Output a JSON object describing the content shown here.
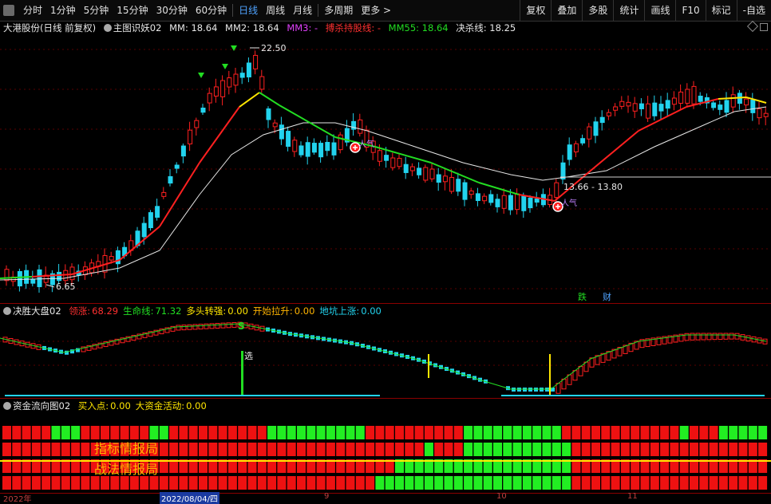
{
  "toolbar": {
    "periods": [
      "分时",
      "1分钟",
      "5分钟",
      "15分钟",
      "30分钟",
      "60分钟",
      "日线",
      "周线",
      "月线",
      "多周期",
      "更多 >"
    ],
    "active_period": "日线",
    "right_buttons": [
      "复权",
      "叠加",
      "多股",
      "统计",
      "画线",
      "F10",
      "标记",
      "-自选"
    ]
  },
  "main_chart": {
    "stock_title": "大港股份(日线 前复权)",
    "indicator_name": "主图识妖02",
    "mm": "MM: 18.64",
    "mm2": "MM2: 18.64",
    "mm3": "MM3: -",
    "bujie": "搏杀持股线: -",
    "mm55": "MM55: 18.64",
    "juesha": "决杀线: 18.25",
    "high_label": "22.50",
    "low_label": "6.65",
    "range_label": "13.66 - 13.80",
    "signal_1": "人气",
    "signal_2": "人气",
    "bottom_tag_1": "跌",
    "bottom_tag_2": "财"
  },
  "panel2": {
    "name": "决胜大盘02",
    "items": [
      {
        "label": "领涨:",
        "value": "68.29"
      },
      {
        "label": "生命线:",
        "value": "71.32"
      },
      {
        "label": "多头转强:",
        "value": "0.00"
      },
      {
        "label": "开始拉升:",
        "value": "0.00"
      },
      {
        "label": "地坑上涨:",
        "value": "0.00"
      }
    ],
    "marker_s": "S",
    "marker_xuan": "选"
  },
  "panel3": {
    "name": "资金流向图02",
    "items": [
      {
        "label": "买入点:",
        "value": "0.00"
      },
      {
        "label": "大资金活动:",
        "value": "0.00"
      }
    ],
    "overlay_1": "指标情报局",
    "overlay_2": "战法情报局"
  },
  "date_axis": {
    "labels": [
      "2022年",
      "2022/08/04/四",
      "9",
      "10",
      "11"
    ]
  },
  "colors": {
    "up": "#ff2020",
    "down": "#22d3ee",
    "accent_blue": "#4fa3ff",
    "line_white": "#e8e8e8",
    "line_green": "#22dd22",
    "line_red": "#ff2020"
  }
}
